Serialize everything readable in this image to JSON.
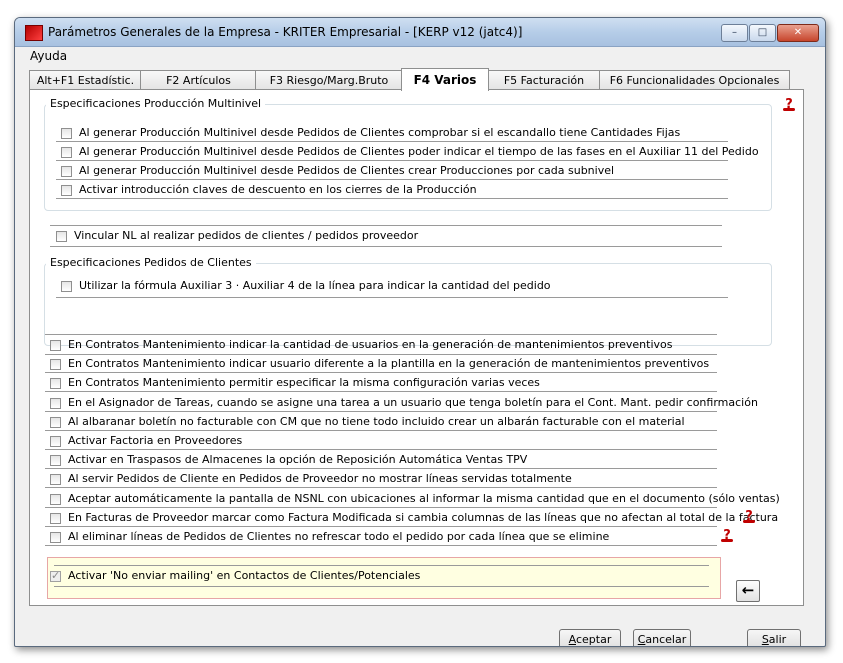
{
  "window": {
    "title": "Parámetros Generales de la Empresa - KRITER Empresarial - [KERP v12 (jatc4)]",
    "controls": {
      "minimize": "–",
      "maximize": "□",
      "close": "✕"
    }
  },
  "menu": {
    "items": [
      {
        "label": "Ayuda"
      }
    ]
  },
  "tabs": [
    {
      "label": "Alt+F1 Estadístic."
    },
    {
      "label": "F2 Artículos"
    },
    {
      "label": "F3 Riesgo/Marg.Bruto"
    },
    {
      "label": "F4 Varios",
      "active": true
    },
    {
      "label": "F5 Facturación"
    },
    {
      "label": "F6 Funcionalidades Opcionales"
    }
  ],
  "groups": {
    "produccion": {
      "title": "Especificaciones Producción Multinivel",
      "items": [
        {
          "label": "Al generar Producción Multinivel desde Pedidos de Clientes comprobar si el escandallo tiene Cantidades Fijas",
          "checked": false
        },
        {
          "label": "Al generar Producción Multinivel desde Pedidos de Clientes poder indicar el tiempo de las fases en el Auxiliar 11 del Pedido",
          "checked": false
        },
        {
          "label": "Al generar Producción Multinivel desde Pedidos de Clientes crear Producciones por cada subnivel",
          "checked": false
        },
        {
          "label": "Activar introducción claves de descuento en los cierres de la Producción",
          "checked": false
        }
      ]
    },
    "vincular": {
      "label": "Vincular NL al realizar  pedidos de clientes /  pedidos proveedor",
      "checked": false
    },
    "pedidos": {
      "title": "Especificaciones Pedidos de Clientes",
      "items": [
        {
          "label": "Utilizar la fórmula Auxiliar 3 · Auxiliar 4 de la línea para indicar la cantidad del pedido",
          "checked": false
        }
      ]
    }
  },
  "options": [
    {
      "label": "En Contratos Mantenimiento indicar la cantidad de usuarios en la generación de mantenimientos preventivos",
      "checked": false
    },
    {
      "label": "En Contratos Mantenimiento indicar usuario diferente a la plantilla en la generación de mantenimientos preventivos",
      "checked": false
    },
    {
      "label": "En Contratos Mantenimiento permitir especificar la misma configuración varias veces",
      "checked": false
    },
    {
      "label": "En el Asignador de Tareas, cuando se asigne una tarea a un usuario que tenga boletín para el Cont. Mant. pedir confirmación",
      "checked": false
    },
    {
      "label": "Al albaranar boletín no facturable con CM que no tiene todo incluido crear un albarán facturable con el material",
      "checked": false
    },
    {
      "label": "Activar Factoria en Proveedores",
      "checked": false
    },
    {
      "label": "Activar en Traspasos de Almacenes la opción de Reposición Automática Ventas TPV",
      "checked": false
    },
    {
      "label": "Al servir Pedidos de Cliente en Pedidos de Proveedor no mostrar líneas servidas totalmente",
      "checked": false
    },
    {
      "label": "Aceptar automáticamente la pantalla de NSNL con ubicaciones al informar la misma cantidad que en el documento (sólo ventas)",
      "checked": false
    },
    {
      "label": "En Facturas de Proveedor marcar como Factura Modificada si cambia columnas de las líneas que no afectan al total de la factura",
      "checked": false
    },
    {
      "label": "Al eliminar líneas de Pedidos de Clientes no refrescar todo el pedido por cada línea que se elimine",
      "checked": false
    }
  ],
  "highlighted_option": {
    "label": "Activar 'No enviar mailing' en Contactos de Clientes/Potenciales",
    "checked": true
  },
  "buttons": {
    "aceptar": {
      "underline": "A",
      "rest": "ceptar"
    },
    "cancelar": {
      "underline": "C",
      "rest": "ancelar"
    },
    "salir": {
      "underline": "S",
      "rest": "alir"
    }
  },
  "colors": {
    "help_icon": "#c00000",
    "highlight_bg": "#ffffe1",
    "highlight_border": "#e7a6a6"
  }
}
